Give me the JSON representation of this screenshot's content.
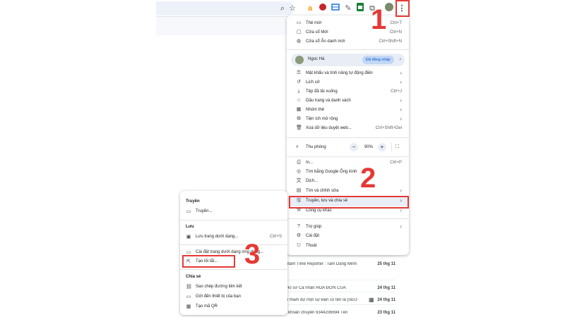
{
  "toolbar": {
    "icons": [
      "search-icon",
      "star-icon",
      "ext-amazon-icon",
      "ext-red-icon",
      "ext-blue-icon",
      "ext-pen-icon",
      "ext-sheets-icon",
      "ext-puzzle-icon",
      "profile-icon",
      "more-icon"
    ]
  },
  "menu": {
    "group1": [
      {
        "label": "Thẻ mới",
        "shortcut": "Ctrl+T"
      },
      {
        "label": "Cửa sổ Mới",
        "shortcut": "Ctrl+N"
      },
      {
        "label": "Cửa sổ Ẩn danh mới",
        "shortcut": "Ctrl+Shift+N"
      }
    ],
    "profile": {
      "name": "Ngoc Hà",
      "badge": "Đã đăng nhập"
    },
    "group2": [
      {
        "label": "Mật khẩu và tính năng tự động điền",
        "shortcut": ""
      },
      {
        "label": "Lịch sử",
        "shortcut": ""
      },
      {
        "label": "Tệp đã tải xuống",
        "shortcut": "Ctrl+J"
      },
      {
        "label": "Dấu trang và danh sách",
        "shortcut": ""
      },
      {
        "label": "Nhóm thẻ",
        "shortcut": ""
      },
      {
        "label": "Tiện ích mở rộng",
        "shortcut": ""
      },
      {
        "label": "Xoá dữ liệu duyệt web...",
        "shortcut": "Ctrl+Shift+Del"
      }
    ],
    "zoom": {
      "label": "Thu phóng",
      "minus": "−",
      "value": "90%",
      "plus": "+"
    },
    "group3": [
      {
        "label": "In...",
        "shortcut": "Ctrl+P"
      },
      {
        "label": "Tìm bằng Google Ống kính",
        "shortcut": ""
      },
      {
        "label": "Dịch...",
        "shortcut": ""
      },
      {
        "label": "Tìm và chỉnh sửa",
        "shortcut": ""
      },
      {
        "label": "Truyền, lưu và chia sẻ",
        "shortcut": ""
      },
      {
        "label": "Công cụ khác",
        "shortcut": ""
      }
    ],
    "group4": [
      {
        "label": "Trợ giúp",
        "shortcut": ""
      },
      {
        "label": "Cài đặt",
        "shortcut": ""
      },
      {
        "label": "Thoát",
        "shortcut": ""
      }
    ]
  },
  "submenu": {
    "section_cast": "Truyền",
    "cast_item": "Truyền...",
    "section_save": "Lưu",
    "save_as": "Lưu trang dưới dạng...",
    "save_as_shortcut": "Ctrl+S",
    "install_app": "Cài đặt trang dưới dạng ứng dụng...",
    "create_shortcut": "Tạo lối tắt...",
    "section_share": "Chia sẻ",
    "copy_link": "Sao chép đường liên kết",
    "send_devices": "Gửi đến thiết bị của bạn",
    "qr_code": "Tạo mã QR"
  },
  "mail_rows": [
    {
      "subject": "ntam Time Reporter : Tam Dang Minh",
      "date": "25 thg 11"
    },
    {
      "subject": "Hồ sơ Cá nhân HÓA ĐƠN CỦA",
      "date": "24 thg 11"
    },
    {
      "subject": "n tham dự một sự kiện có tên là [SEO",
      "date": "24 thg 11"
    },
    {
      "subject": "i khoản chuyển 9344206694 Tên",
      "date": "23 thg 11"
    }
  ],
  "steps": {
    "one": "1",
    "two": "2",
    "three": "3"
  }
}
